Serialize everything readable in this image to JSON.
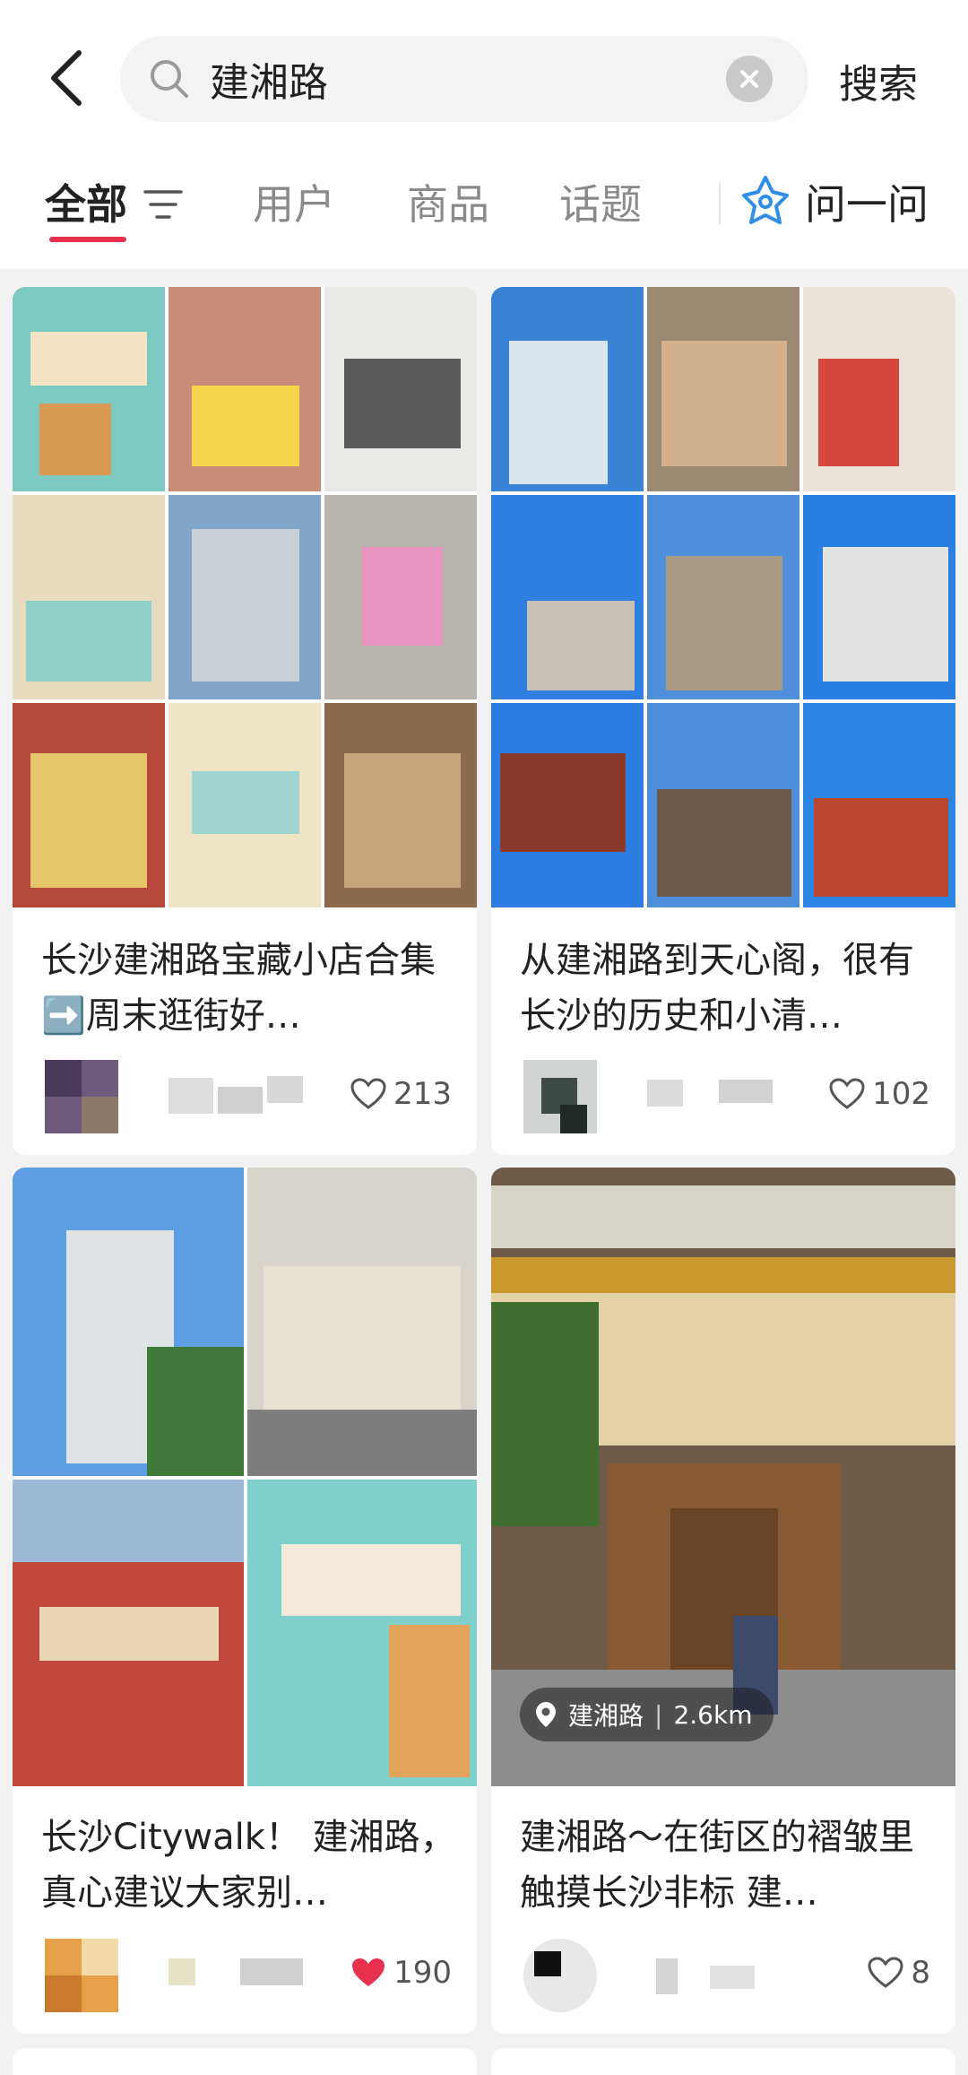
{
  "header": {
    "search_query": "建湘路",
    "search_button": "搜索",
    "icons": {
      "back": "chevron-left-icon",
      "search": "search-icon",
      "clear": "clear-circle-icon"
    }
  },
  "tabs": [
    {
      "label": "全部",
      "active": true
    },
    {
      "label": "用户",
      "active": false
    },
    {
      "label": "商品",
      "active": false
    },
    {
      "label": "话题",
      "active": false
    }
  ],
  "ask": {
    "label": "问一问",
    "icon": "sparkle-star-icon"
  },
  "accent_color": "#e8304f",
  "posts": [
    {
      "title": "长沙建湘路宝藏小店合集➡️周末逛街好…",
      "likes": "213",
      "liked": false,
      "image": "storefront-collage-image"
    },
    {
      "title": "从建湘路到天心阁，很有长沙的历史和小清…",
      "likes": "102",
      "liked": false,
      "image": "city-streets-collage-image"
    },
    {
      "title": "长沙Citywalk！ 建湘路，真心建议大家别…",
      "likes": "190",
      "liked": true,
      "image": "buildings-collage-image"
    },
    {
      "title": "建湘路～在街区的褶皱里触摸长沙非标 建…",
      "likes": "8",
      "liked": false,
      "image": "storefront-photo-image",
      "location": {
        "place": "建湘路",
        "distance": "2.6km"
      }
    }
  ]
}
